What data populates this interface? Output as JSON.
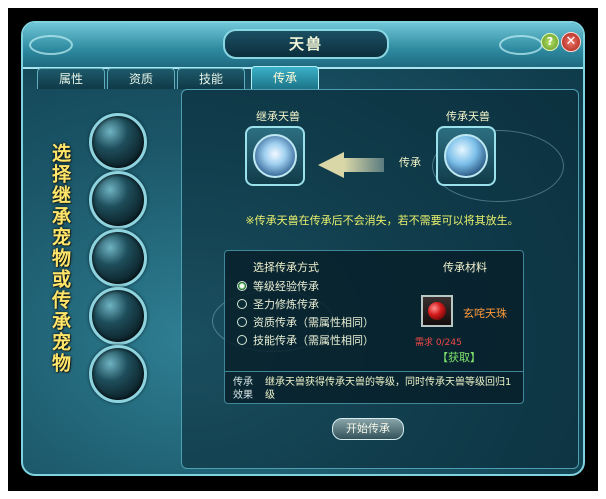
{
  "window": {
    "title": "天兽",
    "help_glyph": "?",
    "close_glyph": "✕"
  },
  "tabs": [
    {
      "label": "属性"
    },
    {
      "label": "资质"
    },
    {
      "label": "技能"
    },
    {
      "label": "传承",
      "active": true
    }
  ],
  "left_panel": {
    "vertical_text": "选择继承宠物或传承宠物"
  },
  "main": {
    "inherit_label": "继承天兽",
    "pass_label": "传承天兽",
    "arrow_label": "传承",
    "note": "※传承天兽在传承后不会消失，若不需要可以将其放生。",
    "method_header": "选择传承方式",
    "material_header": "传承材料",
    "methods": [
      {
        "label": "等级经验传承",
        "selected": true
      },
      {
        "label": "圣力修炼传承",
        "selected": false
      },
      {
        "label": "资质传承（需属性相同）",
        "selected": false
      },
      {
        "label": "技能传承（需属性相同）",
        "selected": false
      }
    ],
    "material_name": "玄咤天珠",
    "requirement": "需求 0/245",
    "obtain_link": "【获取】",
    "effect_label": "传承效果",
    "effect_text": "继承天兽获得传承天兽的等级，同时传承天兽等级回归1级",
    "start_button": "开始传承"
  },
  "colors": {
    "accent": "#8fd3df",
    "vertical_text": "#ffe56a",
    "note": "#e8f06c",
    "material_name": "#ff9a3a",
    "requirement": "#f04848",
    "obtain": "#7fe36b"
  }
}
